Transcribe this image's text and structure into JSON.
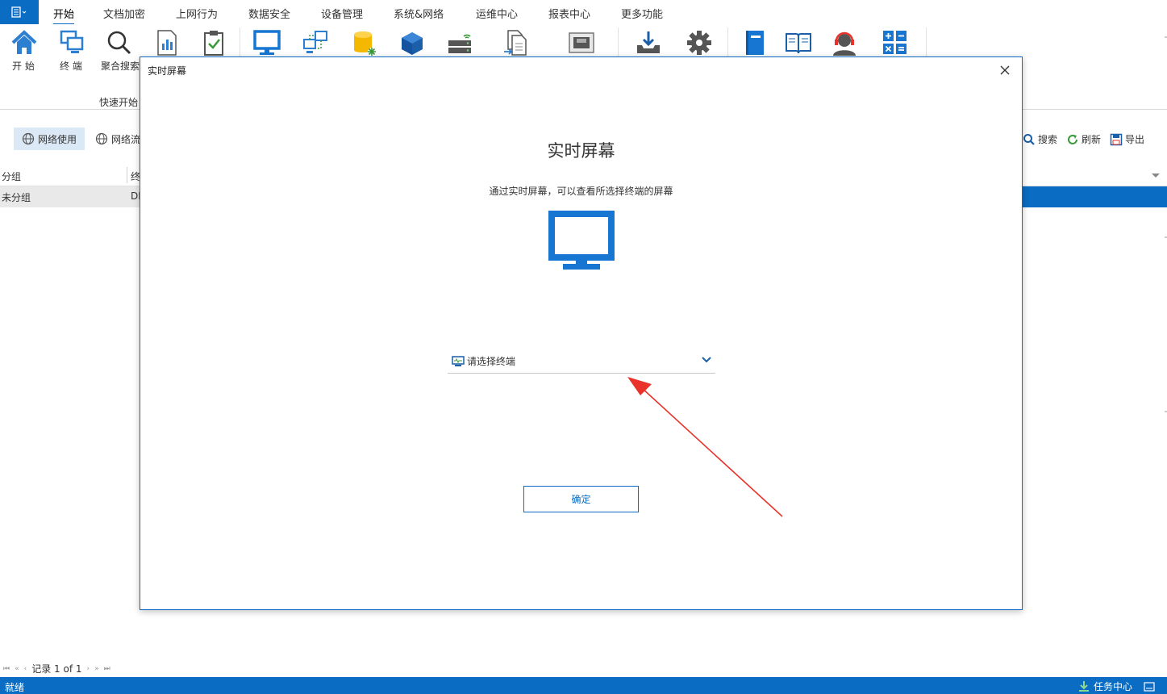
{
  "menubar": {
    "items": [
      "开始",
      "文档加密",
      "上网行为",
      "数据安全",
      "设备管理",
      "系统&网络",
      "运维中心",
      "报表中心",
      "更多功能"
    ],
    "active": "开始"
  },
  "ribbon": {
    "buttons": [
      {
        "label": "开 始",
        "icon": "home-icon"
      },
      {
        "label": "终 端",
        "icon": "terminals-icon"
      },
      {
        "label": "聚合搜索",
        "icon": "search-icon"
      }
    ],
    "group_label": "快速开始"
  },
  "toolbar": {
    "tabs": [
      "网络使用",
      "网络流"
    ],
    "search_label": "搜索",
    "refresh_label": "刷新",
    "export_label": "导出"
  },
  "grid": {
    "headers": [
      "分组",
      "终"
    ],
    "rows": [
      [
        "未分组",
        "DI"
      ]
    ]
  },
  "pager": {
    "text": "记录 1 of 1"
  },
  "status": {
    "left": "就绪",
    "task_center": "任务中心"
  },
  "dialog": {
    "title": "实时屏幕",
    "heading": "实时屏幕",
    "description": "通过实时屏幕，可以查看所选择终端的屏幕",
    "select_placeholder": "请选择终端",
    "confirm_label": "确定"
  },
  "colors": {
    "accent": "#0a6cc2",
    "arrow": "#e8322a"
  }
}
